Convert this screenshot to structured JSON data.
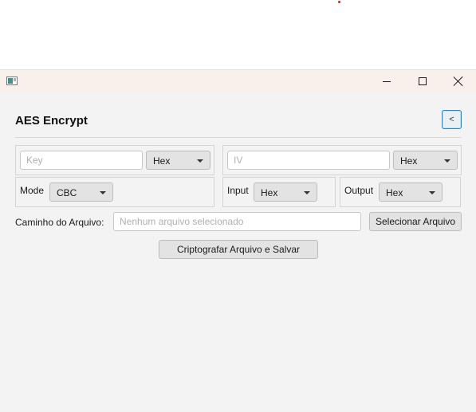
{
  "window": {
    "app_icon": "java-app-icon",
    "controls": {
      "minimize": "minimize-icon",
      "maximize": "maximize-icon",
      "close": "close-icon"
    }
  },
  "header": {
    "title": "AES Encrypt",
    "back_label": "<"
  },
  "key_group": {
    "placeholder": "Key",
    "format": "Hex"
  },
  "iv_group": {
    "placeholder": "IV",
    "format": "Hex"
  },
  "mode_group": {
    "label": "Mode",
    "value": "CBC"
  },
  "input_group": {
    "label": "Input",
    "value": "Hex"
  },
  "output_group": {
    "label": "Output",
    "value": "Hex"
  },
  "file": {
    "label": "Caminho do Arquivo:",
    "placeholder": "Nenhum arquivo selecionado",
    "select_button": "Selecionar Arquivo"
  },
  "actions": {
    "encrypt_button": "Criptografar Arquivo e Salvar"
  },
  "colors": {
    "accent": "#1b86d6",
    "window_bg": "#f3f3f3",
    "titlebar_bg": "#f9f0ec"
  }
}
